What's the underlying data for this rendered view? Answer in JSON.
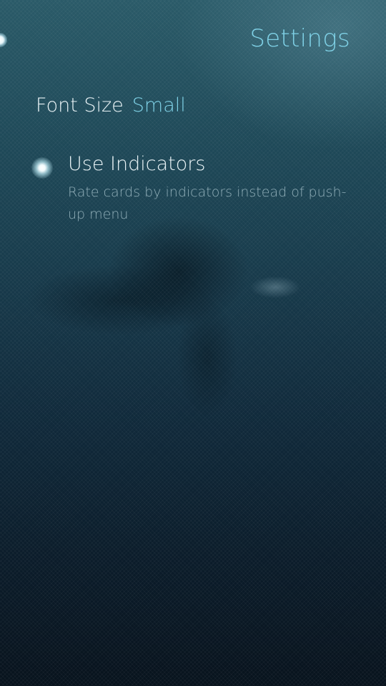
{
  "header": {
    "title": "Settings"
  },
  "font_size": {
    "label": "Font Size",
    "value": "Small"
  },
  "use_indicators": {
    "label": "Use Indicators",
    "description": "Rate cards by indicators instead of push-up menu",
    "checked": true
  },
  "colors": {
    "highlight": "#7fd1e6",
    "primary_text": "#e9f3f6",
    "secondary_text": "#90aeb8"
  }
}
